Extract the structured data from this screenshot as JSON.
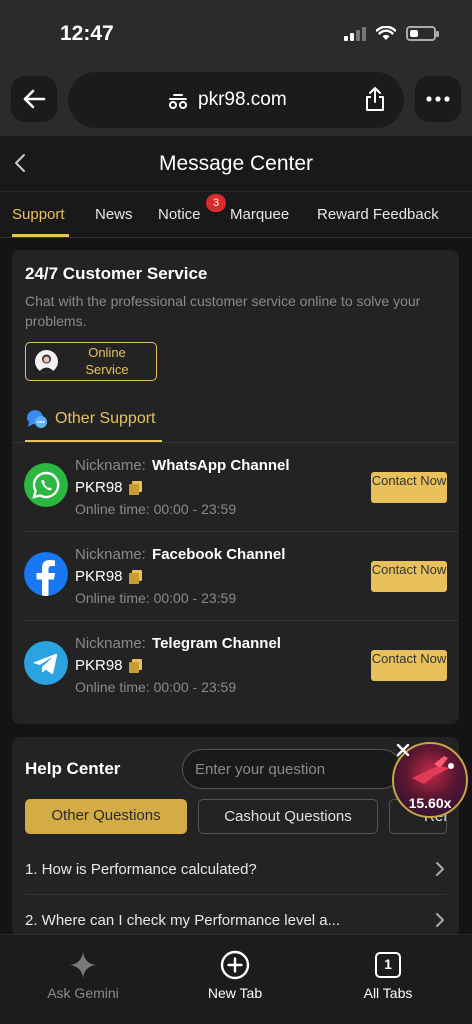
{
  "status_bar": {
    "time": "12:47"
  },
  "browser": {
    "url": "pkr98.com"
  },
  "page": {
    "title": "Message Center",
    "tabs": [
      {
        "label": "Support",
        "active": true
      },
      {
        "label": "News",
        "active": false
      },
      {
        "label": "Notice",
        "active": false,
        "badge": "3"
      },
      {
        "label": "Marquee",
        "active": false
      },
      {
        "label": "Reward Feedback",
        "active": false
      }
    ]
  },
  "customer_service": {
    "title": "24/7 Customer Service",
    "description": "Chat with the professional customer service online to solve your problems.",
    "online_button": "Online Service",
    "other_support_label": "Other Support",
    "nickname_label": "Nickname:",
    "online_time_label": "Online time:",
    "contact_label": "Contact Now",
    "channels": [
      {
        "nickname": "WhatsApp Channel",
        "id": "PKR98",
        "online_time": "00:00 - 23:59",
        "icon": "whatsapp-icon"
      },
      {
        "nickname": "Facebook Channel",
        "id": "PKR98",
        "online_time": "00:00 - 23:59",
        "icon": "facebook-icon"
      },
      {
        "nickname": "Telegram Channel",
        "id": "PKR98",
        "online_time": "00:00 - 23:59",
        "icon": "telegram-icon"
      }
    ]
  },
  "help_center": {
    "title": "Help Center",
    "search_placeholder": "Enter your question",
    "question_tabs": [
      "Other Questions",
      "Cashout Questions",
      "Ref"
    ],
    "faqs": [
      "1. How is Performance calculated?",
      "2. Where can I check my Performance level a..."
    ]
  },
  "floating_ad": {
    "multiplier": "15.60x"
  },
  "bottom_bar": {
    "items": [
      "Ask Gemini",
      "New Tab",
      "All Tabs"
    ],
    "tab_count": "1"
  },
  "colors": {
    "accent": "#e8c15c",
    "background": "#141414",
    "card": "#232323",
    "badge": "#d92b2b"
  }
}
